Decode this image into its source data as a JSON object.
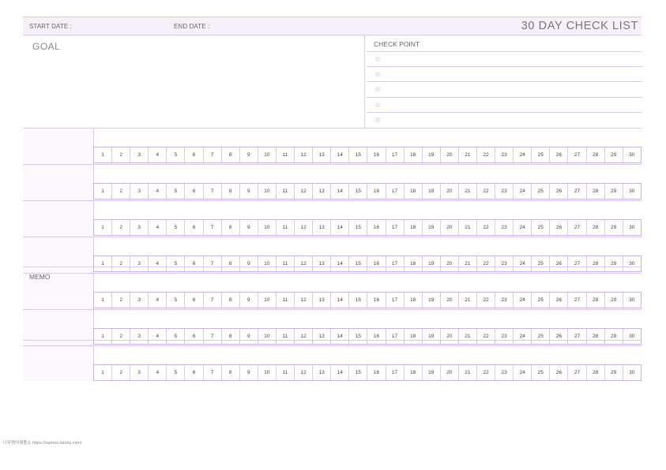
{
  "header": {
    "start_date_label": "START DATE :",
    "end_date_label": "END DATE :",
    "title": "30 DAY CHECK LIST"
  },
  "goal": {
    "label": "GOAL"
  },
  "check_point": {
    "label": "CHECK POINT",
    "item_count": 5
  },
  "habits": {
    "row_count": 7
  },
  "days": [
    "1",
    "2",
    "3",
    "4",
    "5",
    "6",
    "7",
    "8",
    "9",
    "10",
    "11",
    "12",
    "13",
    "14",
    "15",
    "16",
    "17",
    "18",
    "19",
    "20",
    "21",
    "22",
    "23",
    "24",
    "25",
    "26",
    "27",
    "28",
    "29",
    "30"
  ],
  "memo": {
    "label": "MEMO"
  },
  "footer": {
    "credit": "나무명어제품소   https://namoo.tistory.com/"
  },
  "colors": {
    "accent_line": "#d9c8ec",
    "header_bg": "#f6f0fb",
    "bullet": "#f2e6f8"
  }
}
